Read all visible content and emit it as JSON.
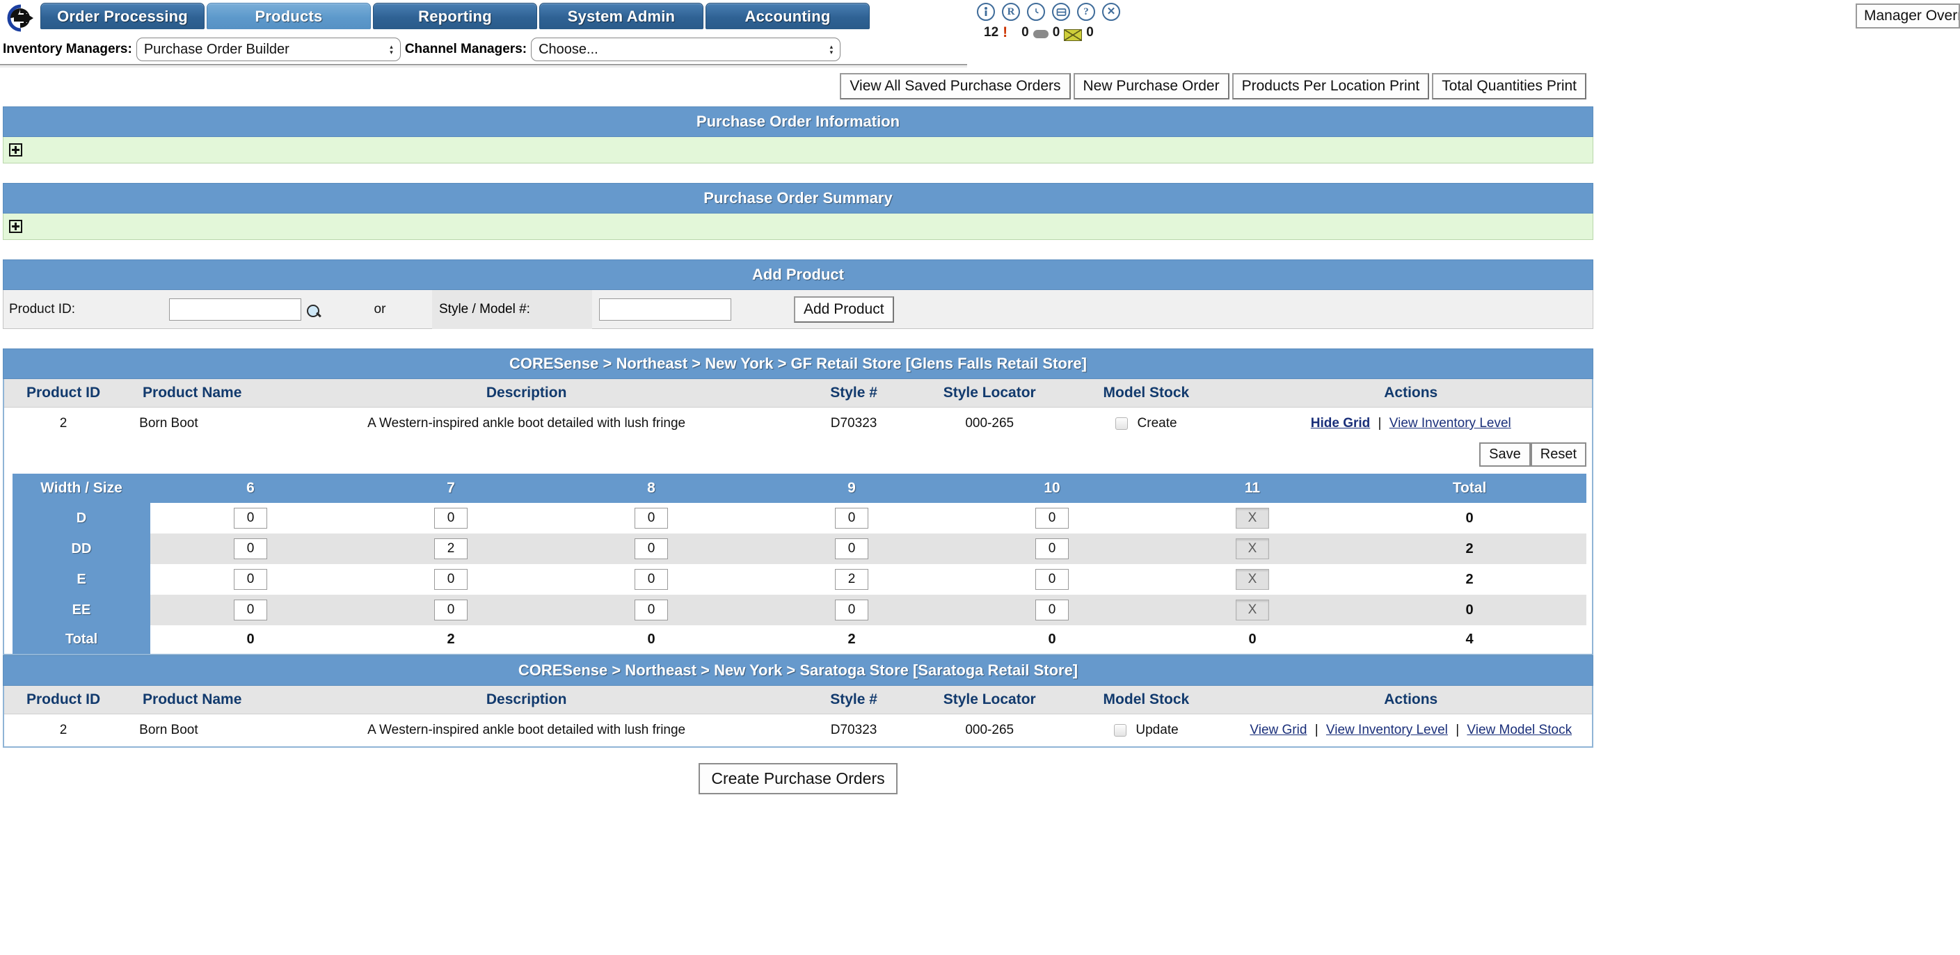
{
  "nav": {
    "logo_icon": "arrow-circle-logo",
    "tabs": [
      {
        "label": "Order Processing",
        "active": false
      },
      {
        "label": "Products",
        "active": true
      },
      {
        "label": "Reporting",
        "active": false
      },
      {
        "label": "System Admin",
        "active": false
      },
      {
        "label": "Accounting",
        "active": false
      }
    ],
    "icons": [
      {
        "name": "info-person-icon",
        "glyph": "ᴵ"
      },
      {
        "name": "registered-icon",
        "glyph": "R"
      },
      {
        "name": "clock-icon",
        "glyph": "◷"
      },
      {
        "name": "message-board-icon",
        "glyph": "▤"
      },
      {
        "name": "help-icon",
        "glyph": "?"
      },
      {
        "name": "close-icon",
        "glyph": "✕"
      }
    ],
    "counters": {
      "alerts": "12",
      "messages": "0",
      "mail": "0",
      "mail_unread": "0"
    },
    "manager_override": "Manager Override"
  },
  "managers": {
    "inventory_label": "Inventory Managers:",
    "inventory_value": "Purchase Order Builder",
    "channel_label": "Channel Managers:",
    "channel_value": "Choose..."
  },
  "toolbar": {
    "view_all_saved": "View All Saved Purchase Orders",
    "new_po": "New Purchase Order",
    "products_per_location": "Products Per Location Print",
    "total_quantities": "Total Quantities Print"
  },
  "panels": {
    "po_information": "Purchase Order Information",
    "po_summary": "Purchase Order Summary",
    "add_product": "Add Product"
  },
  "add_product": {
    "product_id_label": "Product ID:",
    "product_id_value": "",
    "search_icon": "magnifier-icon",
    "or": "or",
    "style_label": "Style / Model #:",
    "style_value": "",
    "button": "Add Product"
  },
  "tables": [
    {
      "breadcrumb": "CORESense > Northeast > New York > GF Retail Store [Glens Falls Retail Store]",
      "headers": [
        "Product ID",
        "Product Name",
        "Description",
        "Style #",
        "Style Locator",
        "Model Stock",
        "Actions"
      ],
      "row": {
        "product_id": "2",
        "product_name": "Born Boot",
        "description": "A Western-inspired ankle boot detailed with lush fringe",
        "style": "D70323",
        "style_locator": "000-265",
        "model_stock_label": "Create",
        "model_stock_checked": false,
        "actions": [
          {
            "label": "Hide Grid",
            "bold": true
          },
          {
            "label": "View Inventory Level",
            "bold": false
          }
        ]
      },
      "save_label": "Save",
      "reset_label": "Reset"
    },
    {
      "breadcrumb": "CORESense > Northeast > New York > Saratoga Store [Saratoga Retail Store]",
      "headers": [
        "Product ID",
        "Product Name",
        "Description",
        "Style #",
        "Style Locator",
        "Model Stock",
        "Actions"
      ],
      "row": {
        "product_id": "2",
        "product_name": "Born Boot",
        "description": "A Western-inspired ankle boot detailed with lush fringe",
        "style": "D70323",
        "style_locator": "000-265",
        "model_stock_label": "Update",
        "model_stock_checked": false,
        "actions": [
          {
            "label": "View Grid",
            "bold": false
          },
          {
            "label": "View Inventory Level",
            "bold": false
          },
          {
            "label": "View Model Stock",
            "bold": false
          }
        ]
      }
    }
  ],
  "size_grid": {
    "corner_label": "Width / Size",
    "total_label": "Total",
    "sizes": [
      "6",
      "7",
      "8",
      "9",
      "10",
      "11"
    ],
    "widths": [
      "D",
      "DD",
      "E",
      "EE"
    ],
    "values": [
      [
        "0",
        "0",
        "0",
        "0",
        "0",
        "X"
      ],
      [
        "0",
        "2",
        "0",
        "0",
        "0",
        "X"
      ],
      [
        "0",
        "0",
        "0",
        "2",
        "0",
        "X"
      ],
      [
        "0",
        "0",
        "0",
        "0",
        "0",
        "X"
      ]
    ],
    "disabled_columns": [
      5
    ],
    "row_totals": [
      "0",
      "2",
      "2",
      "0"
    ],
    "column_totals": [
      "0",
      "2",
      "0",
      "2",
      "0",
      "0"
    ],
    "grand_total": "4"
  },
  "footer": {
    "create_purchase_orders": "Create Purchase Orders"
  },
  "colors": {
    "panel_header": "#6699cc",
    "panel_body_green": "#e3f7d9",
    "table_header_bg": "#e5e5e5",
    "table_header_text": "#123a6d",
    "link": "#1a2f7a",
    "tab_active": "#6699cc",
    "tab_inactive": "#2f6294",
    "alert_red": "#cc3300"
  }
}
